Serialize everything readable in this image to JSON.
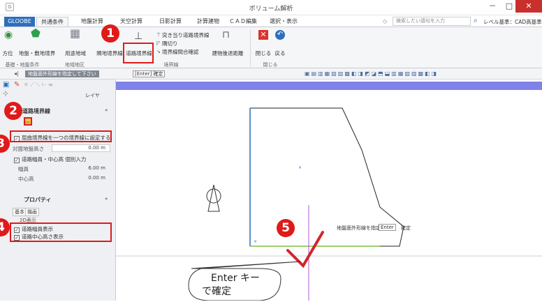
{
  "window": {
    "title": "ボリューム解析",
    "min": "－",
    "max": "□",
    "close": "✕"
  },
  "tabs": [
    "GLOOBE",
    "共通条件",
    "地盤計算",
    "天空計算",
    "日影計算",
    "計算建物",
    "ＣＡＤ編集",
    "選択・表示"
  ],
  "search": {
    "placeholder": "検索したい語句を入力"
  },
  "level_base": "レベル基準：CAD高基準",
  "ribbon": {
    "btn_direction": "方位",
    "btn_site": "地盤・敷地境界",
    "btn_usezone": "用途地域",
    "btn_adjacent": "隣地境界線",
    "btn_road": "道路境界線",
    "btn_deadend": "突き当り道路境界線",
    "btn_corner": "隅切り",
    "btn_confirm": "境界線間合確認",
    "btn_setback": "建物後退距離",
    "btn_close": "閉じる",
    "btn_back": "戻る",
    "grp_basic": "基礎・地盤条件",
    "grp_zone": "地域地区",
    "grp_boundary": "境界線",
    "grp_close": "閉じる"
  },
  "toolbar2": {
    "prompt": "地盤面外形線を指定して下さい",
    "enter": "[Enter] 確定"
  },
  "sidebar": {
    "layer": "レイヤ",
    "road_panel": "道路境界線",
    "chk_curve": "屈曲境界線を一つの境界線に設定する",
    "opp_height_label": "対面地盤高さ",
    "opp_height_value": "0.00 m",
    "chk_width_center": "道路幅員・中心高 個別入力",
    "width_label": "幅員",
    "width_value": "6.00 m",
    "center_label": "中心高",
    "center_value": "0.00 m",
    "prop_head": "プロパティ",
    "tab_basic": "基本",
    "tab_draw": "描画",
    "display_2d": "2D表示",
    "chk_show_width": "道路幅員表示",
    "chk_show_center": "道路中心高さ表示"
  },
  "canvas": {
    "instruction": "地盤面外形線を指定",
    "enter": "Enter",
    "confirm": "確定",
    "bubble_line1": "Enter キー",
    "bubble_line2": "で確定"
  },
  "badges": [
    "1",
    "2",
    "3",
    "4",
    "5"
  ],
  "colors": {
    "accent": "#e01a1a",
    "file_tab": "#2c6fbd",
    "band": "#7f82e9",
    "check": "#d1262e"
  }
}
